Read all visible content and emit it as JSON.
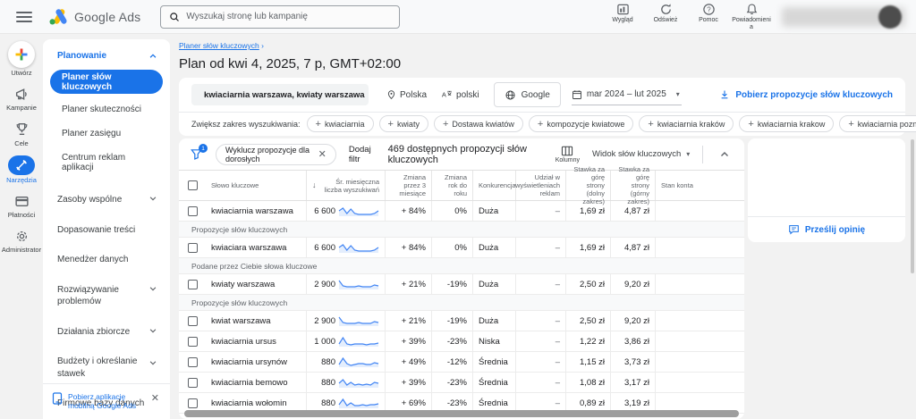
{
  "colors": {
    "accent": "#1a73e8",
    "spark": "#4285f4",
    "spark_fill": "rgba(66,133,244,0.14)"
  },
  "topbar": {
    "product": "Google Ads",
    "search_placeholder": "Wyszukaj stronę lub kampanię",
    "actions": [
      {
        "icon": "appearance-icon",
        "label": "Wygląd"
      },
      {
        "icon": "refresh-icon",
        "label": "Odśwież"
      },
      {
        "icon": "help-icon",
        "label": "Pomoc"
      },
      {
        "icon": "notifications-icon",
        "label": "Powiadomienia"
      }
    ]
  },
  "rail": {
    "items": [
      {
        "icon": "create-plus-icon",
        "label": "Utwórz"
      },
      {
        "icon": "campaigns-icon",
        "label": "Kampanie"
      },
      {
        "icon": "goals-icon",
        "label": "Cele"
      },
      {
        "icon": "tools-icon",
        "label": "Narzędzia",
        "active": true
      },
      {
        "icon": "billing-icon",
        "label": "Płatności"
      },
      {
        "icon": "admin-icon",
        "label": "Administrator"
      }
    ]
  },
  "sidebar": {
    "section_title": "Planowanie",
    "planning_items": [
      "Planer słów kluczowych",
      "Planer skuteczności",
      "Planer zasięgu",
      "Centrum reklam aplikacji"
    ],
    "groups": [
      {
        "label": "Zasoby wspólne",
        "chevron": true
      },
      {
        "label": "Dopasowanie treści",
        "chevron": false
      },
      {
        "label": "Menedżer danych",
        "chevron": false
      },
      {
        "label": "Rozwiązywanie problemów",
        "chevron": true
      },
      {
        "label": "Działania zbiorcze",
        "chevron": true
      },
      {
        "label": "Budżety i określanie stawek",
        "chevron": true
      },
      {
        "label": "Firmowe bazy danych",
        "chevron": false
      }
    ],
    "promo": "Pobierz aplikację mobilną Google Ads"
  },
  "header": {
    "breadcrumb": "Planer słów kluczowych",
    "breadcrumb_sep": "›",
    "title": "Plan od kwi 4, 2025, 7 p, GMT+02:00"
  },
  "searchbar": {
    "query": "kwiaciarnia warszawa, kwiaty warszawa",
    "location": "Polska",
    "language": "polski",
    "network": "Google",
    "date_range": "mar 2024 – lut 2025",
    "download_label": "Pobierz propozycje słów kluczowych"
  },
  "broaden": {
    "label": "Zwiększ zakres wyszukiwania:",
    "chips": [
      "kwiaciarnia",
      "kwiaty",
      "Dostawa kwiatów",
      "kompozycje kwiatowe",
      "kwiaciarnia kraków",
      "kwiaciarnia krakow",
      "kwiaciarnia poznań"
    ]
  },
  "toolbar": {
    "filter_badge": "1",
    "filter_chip": "Wyklucz propozycje dla dorosłych",
    "add_filter": "Dodaj filtr",
    "result_count": "469 dostępnych propozycji słów kluczowych",
    "columns_label": "Kolumny",
    "view_label": "Widok słów kluczowych"
  },
  "feedback": {
    "label": "Prześlij opinię"
  },
  "table": {
    "columns": [
      "",
      "Słowo kluczowe",
      "Śr. miesięczna liczba wyszukiwań",
      "Zmiana przez 3 miesiące",
      "Zmiana rok do roku",
      "Konkurencja",
      "Udział w wyświetleniach reklam",
      "Stawka za górę strony (dolny zakres)",
      "Stawka za górę strony (górny zakres)",
      "Stan konta"
    ],
    "rows": [
      {
        "type": "keyword",
        "keyword": "kwiaciarnia warszawa",
        "volume": "6 600",
        "change_3m": "+ 84%",
        "change_yoy": "0%",
        "competition": "Duża",
        "ad_impression_share": "–",
        "bid_low": "1,69 zł",
        "bid_high": "4,87 zł",
        "account_status": "",
        "spark": [
          5,
          8,
          2,
          7,
          2,
          1,
          1,
          1,
          1,
          2,
          5
        ]
      },
      {
        "type": "section",
        "label": "Propozycje słów kluczowych"
      },
      {
        "type": "keyword",
        "keyword": "kwiaciara warszawa",
        "volume": "6 600",
        "change_3m": "+ 84%",
        "change_yoy": "0%",
        "competition": "Duża",
        "ad_impression_share": "–",
        "bid_low": "1,69 zł",
        "bid_high": "4,87 zł",
        "account_status": "",
        "spark": [
          5,
          8,
          2,
          7,
          2,
          1,
          1,
          1,
          1,
          2,
          5
        ]
      },
      {
        "type": "section",
        "label": "Podane przez Ciebie słowa kluczowe"
      },
      {
        "type": "keyword",
        "keyword": "kwiaty warszawa",
        "volume": "2 900",
        "change_3m": "+ 21%",
        "change_yoy": "-19%",
        "competition": "Duża",
        "ad_impression_share": "–",
        "bid_low": "2,50 zł",
        "bid_high": "9,20 zł",
        "account_status": "",
        "spark": [
          9,
          3,
          2,
          2,
          2,
          3,
          2,
          2,
          2,
          4,
          3
        ]
      },
      {
        "type": "section",
        "label": "Propozycje słów kluczowych"
      },
      {
        "type": "keyword",
        "keyword": "kwiat warszawa",
        "volume": "2 900",
        "change_3m": "+ 21%",
        "change_yoy": "-19%",
        "competition": "Duża",
        "ad_impression_share": "–",
        "bid_low": "2,50 zł",
        "bid_high": "9,20 zł",
        "account_status": "",
        "spark": [
          9,
          3,
          2,
          2,
          2,
          3,
          2,
          2,
          2,
          4,
          3
        ]
      },
      {
        "type": "keyword",
        "keyword": "kwiaciarnia ursus",
        "volume": "1 000",
        "change_3m": "+ 39%",
        "change_yoy": "-23%",
        "competition": "Niska",
        "ad_impression_share": "–",
        "bid_low": "1,22 zł",
        "bid_high": "3,86 zł",
        "account_status": "",
        "spark": [
          2,
          9,
          2,
          1,
          2,
          2,
          2,
          1,
          2,
          2,
          3
        ]
      },
      {
        "type": "keyword",
        "keyword": "kwiaciarnia ursynów",
        "volume": "880",
        "change_3m": "+ 49%",
        "change_yoy": "-12%",
        "competition": "Średnia",
        "ad_impression_share": "–",
        "bid_low": "1,15 zł",
        "bid_high": "3,73 zł",
        "account_status": "",
        "spark": [
          2,
          9,
          3,
          1,
          2,
          3,
          3,
          2,
          2,
          4,
          3
        ]
      },
      {
        "type": "keyword",
        "keyword": "kwiaciarnia bemowo",
        "volume": "880",
        "change_3m": "+ 39%",
        "change_yoy": "-23%",
        "competition": "Średnia",
        "ad_impression_share": "–",
        "bid_low": "1,08 zł",
        "bid_high": "3,17 zł",
        "account_status": "",
        "spark": [
          4,
          8,
          2,
          5,
          2,
          3,
          2,
          3,
          2,
          5,
          4
        ]
      },
      {
        "type": "keyword",
        "keyword": "kwiaciarnia wołomin",
        "volume": "880",
        "change_3m": "+ 69%",
        "change_yoy": "-23%",
        "competition": "Średnia",
        "ad_impression_share": "–",
        "bid_low": "0,89 zł",
        "bid_high": "3,19 zł",
        "account_status": "",
        "spark": [
          3,
          9,
          2,
          5,
          2,
          2,
          3,
          2,
          3,
          3,
          4
        ]
      }
    ]
  }
}
